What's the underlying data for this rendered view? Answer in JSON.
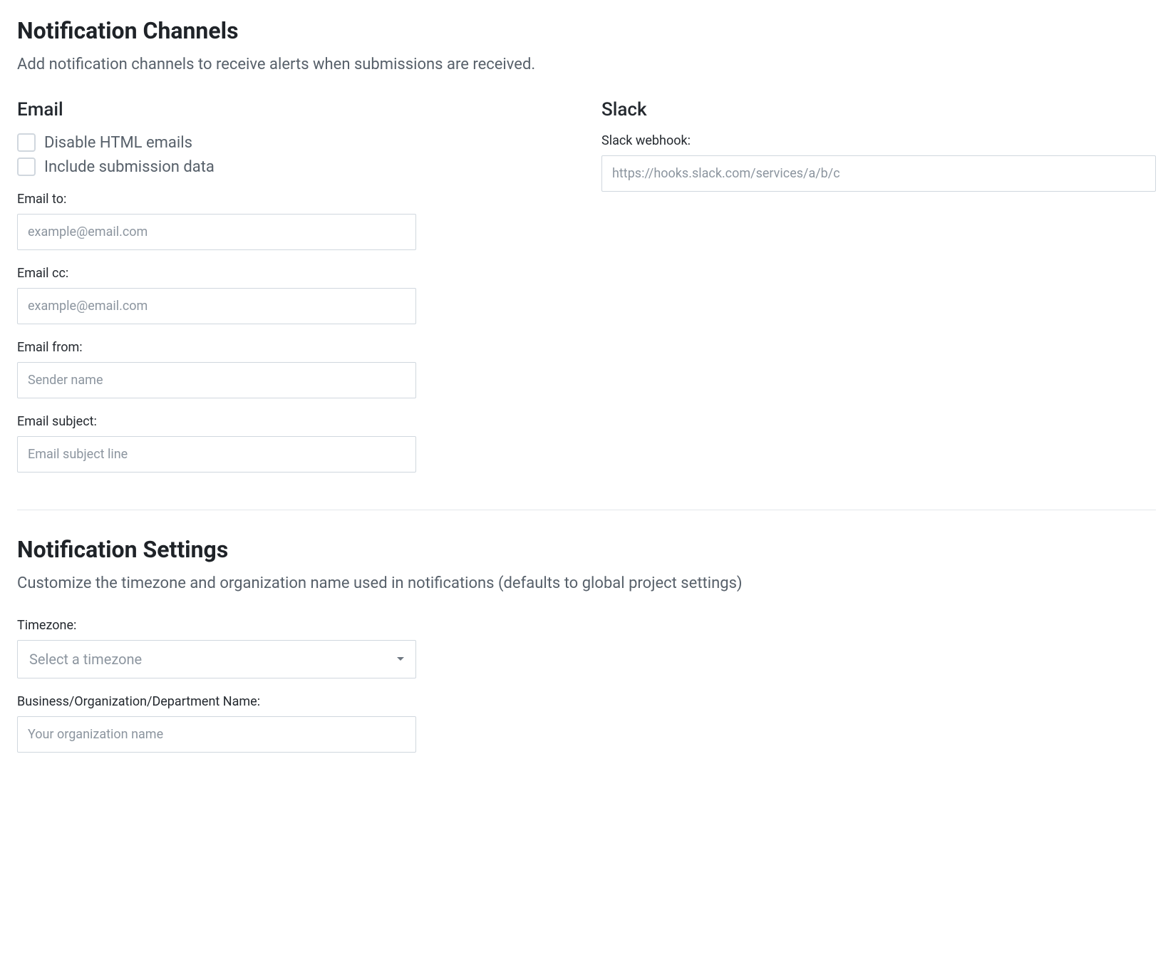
{
  "channels": {
    "title": "Notification Channels",
    "desc": "Add notification channels to receive alerts when submissions are received.",
    "email": {
      "title": "Email",
      "disable_html_label": "Disable HTML emails",
      "include_submission_label": "Include submission data",
      "email_to_label": "Email to:",
      "email_to_placeholder": "example@email.com",
      "email_cc_label": "Email cc:",
      "email_cc_placeholder": "example@email.com",
      "email_from_label": "Email from:",
      "email_from_placeholder": "Sender name",
      "email_subject_label": "Email subject:",
      "email_subject_placeholder": "Email subject line"
    },
    "slack": {
      "title": "Slack",
      "webhook_label": "Slack webhook:",
      "webhook_placeholder": "https://hooks.slack.com/services/a/b/c"
    }
  },
  "settings": {
    "title": "Notification Settings",
    "desc": "Customize the timezone and organization name used in notifications (defaults to global project settings)",
    "timezone_label": "Timezone:",
    "timezone_placeholder": "Select a timezone",
    "org_label": "Business/Organization/Department Name:",
    "org_placeholder": "Your organization name"
  }
}
